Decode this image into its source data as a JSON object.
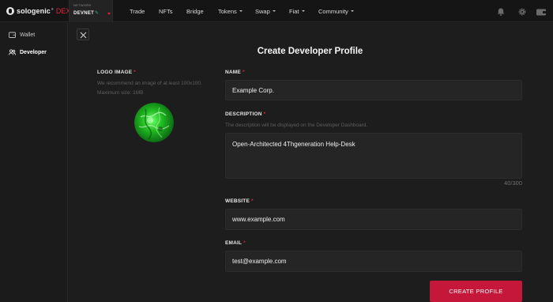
{
  "app": {
    "brand": "sologenic",
    "brand_sup": "®",
    "brand_suffix": "DEX"
  },
  "network": {
    "label": "NETWORK",
    "value": "DEVNET"
  },
  "nav": {
    "items": [
      {
        "label": "Trade",
        "dropdown": false
      },
      {
        "label": "NFTs",
        "dropdown": false
      },
      {
        "label": "Bridge",
        "dropdown": false
      },
      {
        "label": "Tokens",
        "dropdown": true
      },
      {
        "label": "Swap",
        "dropdown": true
      },
      {
        "label": "Fiat",
        "dropdown": true
      },
      {
        "label": "Community",
        "dropdown": true
      }
    ]
  },
  "top_icons": [
    "bell-icon",
    "settings-icon",
    "wallet-icon"
  ],
  "sidebar": {
    "items": [
      {
        "label": "Wallet",
        "icon": "wallet-icon",
        "active": false
      },
      {
        "label": "Developer",
        "icon": "users-icon",
        "active": true
      }
    ]
  },
  "form": {
    "title": "Create Developer Profile",
    "logo": {
      "label": "LOGO IMAGE",
      "required_mark": "*",
      "help": "We recommend an image of at least 100x100. Maximum size: 1MB"
    },
    "name": {
      "label": "NAME",
      "required_mark": "*",
      "value": "Example Corp."
    },
    "description": {
      "label": "DESCRIPTION",
      "required_mark": "*",
      "help": "The description will be displayed on the Developer Dashboard.",
      "value": "Open-Architected 4Thgeneration Help-Desk",
      "counter": "40/300"
    },
    "website": {
      "label": "WEBSITE",
      "required_mark": "*",
      "value": "www.example.com"
    },
    "email": {
      "label": "EMAIL",
      "required_mark": "*",
      "value": "test@example.com"
    },
    "submit_label": "CREATE PROFILE"
  },
  "colors": {
    "accent": "#c4173a",
    "required": "#e0243c",
    "background": "#1d1d1d",
    "input_bg": "#252525",
    "topbar_bg": "#151515"
  }
}
